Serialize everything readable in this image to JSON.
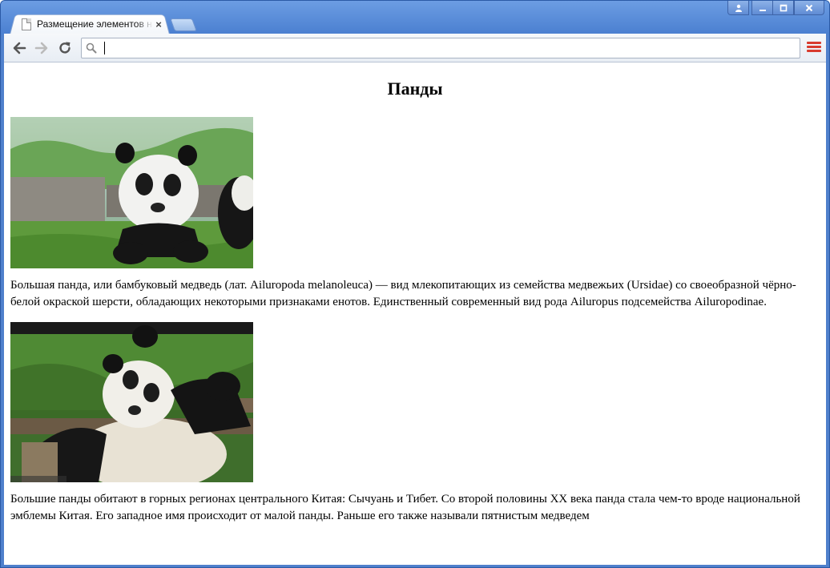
{
  "browser": {
    "tab_title": "Размещение элементов на",
    "tab_close": "×",
    "address_value": "",
    "icons": {
      "back": "arrow-left-icon",
      "forward": "arrow-right-icon",
      "reload": "reload-icon",
      "search": "search-icon",
      "menu": "hamburger-menu-icon",
      "user": "user-icon",
      "minimize": "minimize-icon",
      "maximize": "maximize-icon",
      "close": "close-icon"
    },
    "colors": {
      "frame": "#4f80cc",
      "menu_accent": "#d83b2e"
    }
  },
  "page": {
    "heading": "Панды",
    "paragraphs": [
      "Большая панда, или бамбуковый медведь (лат. Ailuropoda melanoleuca) — вид млекопитающих из семейства медвежьих (Ursidae) со своеобразной чёрно-белой окраской шерсти, обладающих некоторыми признаками енотов. Единственный современный вид рода Ailuropus подсемейства Ailuropodinae.",
      "Большие панды обитают в горных регионах центрального Китая: Сычуань и Тибет. Со второй половины XX века панда стала чем-то вроде национальной эмблемы Китая. Его западное имя происходит от малой панды. Раньше его также называли пятнистым медведем"
    ]
  }
}
